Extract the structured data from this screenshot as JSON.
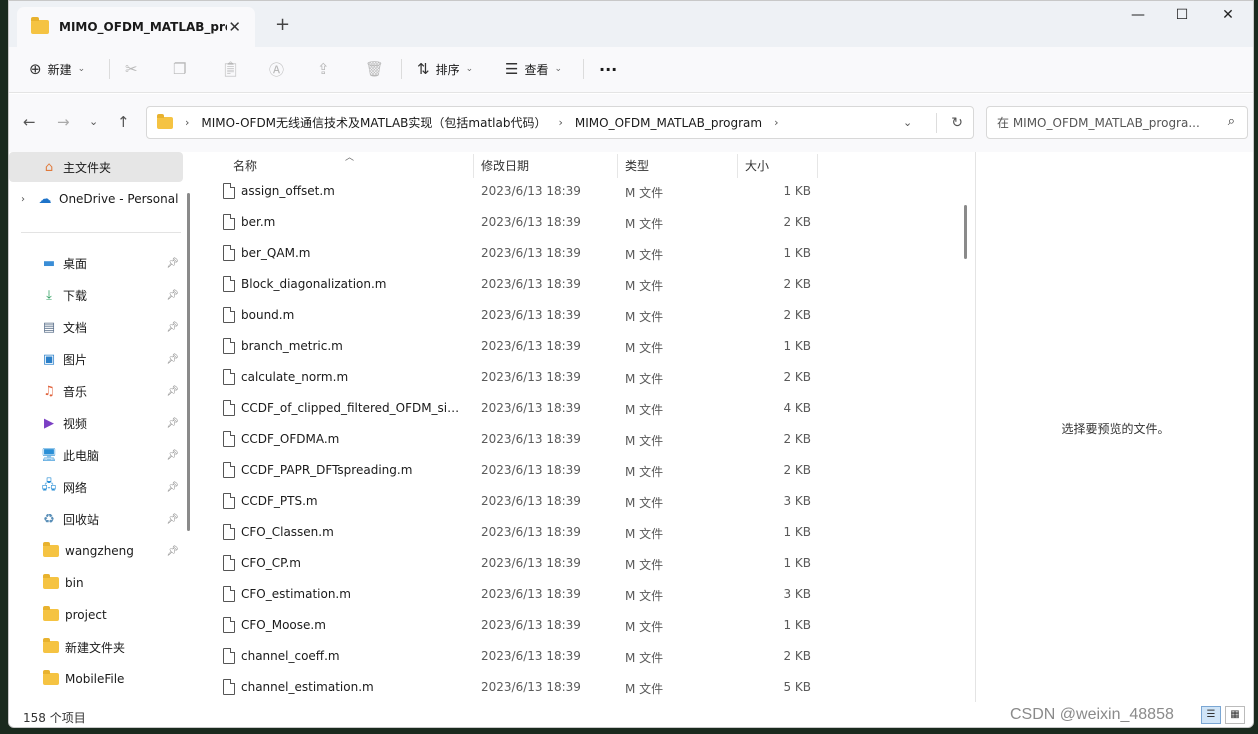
{
  "window": {
    "tab_title": "MIMO_OFDM_MATLAB_progr",
    "tab_close": "✕",
    "new_tab": "+",
    "minimize": "—",
    "maximize": "☐",
    "close": "✕"
  },
  "toolbar": {
    "new_label": "新建",
    "sort_label": "排序",
    "view_label": "查看",
    "more_label": "···"
  },
  "address": {
    "crumbs": [
      "MIMO-OFDM无线通信技术及MATLAB实现（包括matlab代码）",
      "MIMO_OFDM_MATLAB_program"
    ],
    "search_placeholder": "在 MIMO_OFDM_MATLAB_progra..."
  },
  "sidebar": {
    "items": [
      {
        "label": "主文件夹",
        "icon": "home-icon"
      },
      {
        "label": "OneDrive - Personal",
        "icon": "cloud-icon"
      },
      {
        "label": "桌面",
        "icon": "desktop-icon"
      },
      {
        "label": "下载",
        "icon": "download-icon"
      },
      {
        "label": "文档",
        "icon": "document-icon"
      },
      {
        "label": "图片",
        "icon": "picture-icon"
      },
      {
        "label": "音乐",
        "icon": "music-icon"
      },
      {
        "label": "视频",
        "icon": "video-icon"
      },
      {
        "label": "此电脑",
        "icon": "computer-icon"
      },
      {
        "label": "网络",
        "icon": "network-icon"
      },
      {
        "label": "回收站",
        "icon": "recycle-bin-icon"
      },
      {
        "label": "wangzheng",
        "icon": "folder-icon"
      },
      {
        "label": "bin",
        "icon": "folder-icon"
      },
      {
        "label": "project",
        "icon": "folder-icon"
      },
      {
        "label": "新建文件夹",
        "icon": "folder-icon"
      },
      {
        "label": "MobileFile",
        "icon": "folder-icon"
      }
    ]
  },
  "filelist": {
    "headers": {
      "name": "名称",
      "date": "修改日期",
      "type": "类型",
      "size": "大小"
    },
    "rows": [
      {
        "name": "assign_offset.m",
        "date": "2023/6/13 18:39",
        "type": "M 文件",
        "size": "1 KB"
      },
      {
        "name": "ber.m",
        "date": "2023/6/13 18:39",
        "type": "M 文件",
        "size": "2 KB"
      },
      {
        "name": "ber_QAM.m",
        "date": "2023/6/13 18:39",
        "type": "M 文件",
        "size": "1 KB"
      },
      {
        "name": "Block_diagonalization.m",
        "date": "2023/6/13 18:39",
        "type": "M 文件",
        "size": "2 KB"
      },
      {
        "name": "bound.m",
        "date": "2023/6/13 18:39",
        "type": "M 文件",
        "size": "2 KB"
      },
      {
        "name": "branch_metric.m",
        "date": "2023/6/13 18:39",
        "type": "M 文件",
        "size": "1 KB"
      },
      {
        "name": "calculate_norm.m",
        "date": "2023/6/13 18:39",
        "type": "M 文件",
        "size": "2 KB"
      },
      {
        "name": "CCDF_of_clipped_filtered_OFDM_sign...",
        "date": "2023/6/13 18:39",
        "type": "M 文件",
        "size": "4 KB"
      },
      {
        "name": "CCDF_OFDMA.m",
        "date": "2023/6/13 18:39",
        "type": "M 文件",
        "size": "2 KB"
      },
      {
        "name": "CCDF_PAPR_DFTspreading.m",
        "date": "2023/6/13 18:39",
        "type": "M 文件",
        "size": "2 KB"
      },
      {
        "name": "CCDF_PTS.m",
        "date": "2023/6/13 18:39",
        "type": "M 文件",
        "size": "3 KB"
      },
      {
        "name": "CFO_Classen.m",
        "date": "2023/6/13 18:39",
        "type": "M 文件",
        "size": "1 KB"
      },
      {
        "name": "CFO_CP.m",
        "date": "2023/6/13 18:39",
        "type": "M 文件",
        "size": "1 KB"
      },
      {
        "name": "CFO_estimation.m",
        "date": "2023/6/13 18:39",
        "type": "M 文件",
        "size": "3 KB"
      },
      {
        "name": "CFO_Moose.m",
        "date": "2023/6/13 18:39",
        "type": "M 文件",
        "size": "1 KB"
      },
      {
        "name": "channel_coeff.m",
        "date": "2023/6/13 18:39",
        "type": "M 文件",
        "size": "2 KB"
      },
      {
        "name": "channel_estimation.m",
        "date": "2023/6/13 18:39",
        "type": "M 文件",
        "size": "5 KB"
      }
    ]
  },
  "preview": {
    "text": "选择要预览的文件。"
  },
  "status": {
    "count": "158 个项目"
  },
  "watermark": "CSDN @weixin_48858"
}
